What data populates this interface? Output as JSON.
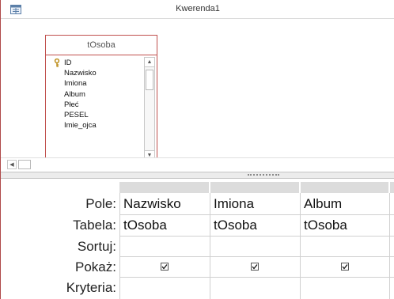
{
  "window": {
    "title": "Kwerenda1"
  },
  "table": {
    "name": "tOsoba",
    "fields": [
      "ID",
      "Nazwisko",
      "Imiona",
      "Album",
      "Płeć",
      "PESEL",
      "Imie_ojca"
    ]
  },
  "grid": {
    "row_labels": [
      "Pole:",
      "Tabela:",
      "Sortuj:",
      "Pokaż:",
      "Kryteria:"
    ],
    "columns": [
      {
        "field": "Nazwisko",
        "table": "tOsoba",
        "sort": "",
        "show": true,
        "criteria": ""
      },
      {
        "field": "Imiona",
        "table": "tOsoba",
        "sort": "",
        "show": true,
        "criteria": ""
      },
      {
        "field": "Album",
        "table": "tOsoba",
        "sort": "",
        "show": true,
        "criteria": ""
      }
    ]
  },
  "icons": {
    "title": "query-design-icon",
    "primary_key": "key-icon",
    "scroll_up": "scroll-up-icon",
    "scroll_down": "scroll-down-icon",
    "scroll_left": "scroll-left-icon"
  },
  "colors": {
    "accent": "#c0504d",
    "header_gray": "#dcdcdc"
  }
}
